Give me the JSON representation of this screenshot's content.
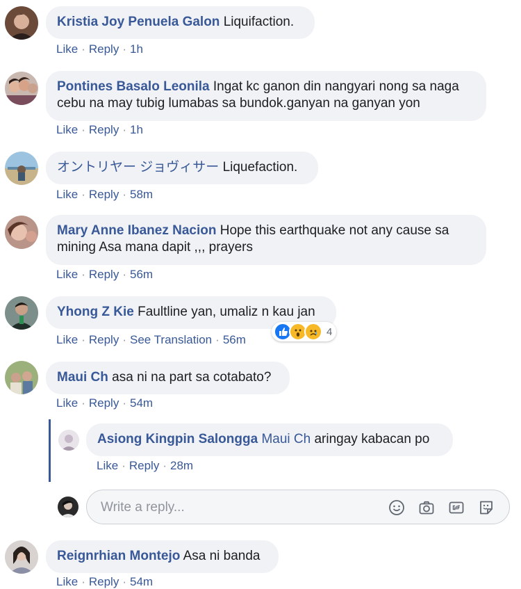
{
  "comments": [
    {
      "author": "Kristia Joy Penuela Galon",
      "text": "Liquifaction.",
      "like": "Like",
      "reply": "Reply",
      "time": "1h"
    },
    {
      "author": "Pontines Basalo Leonila",
      "text": "Ingat kc ganon din nangyari nong sa naga",
      "text2": "cebu na may tubig lumabas sa bundok.ganyan na ganyan yon",
      "like": "Like",
      "reply": "Reply",
      "time": "1h"
    },
    {
      "author": "オントリヤー ジョヴィサー",
      "text": "Liquefaction.",
      "like": "Like",
      "reply": "Reply",
      "time": "58m"
    },
    {
      "author": "Mary Anne Ibanez Nacion",
      "text": "Hope this earthquake not any cause sa",
      "text2": "mining Asa mana dapit ,,, prayers",
      "like": "Like",
      "reply": "Reply",
      "time": "56m"
    },
    {
      "author": "Yhong Z Kie",
      "text": "Faultline yan, umaliz n kau jan",
      "like": "Like",
      "reply": "Reply",
      "translate": "See Translation",
      "time": "56m",
      "reaction_count": "4"
    },
    {
      "author": "Maui Ch",
      "text": "asa ni na part sa cotabato?",
      "like": "Like",
      "reply": "Reply",
      "time": "54m"
    },
    {
      "author": "Reignrhian Montejo",
      "text": "Asa ni banda",
      "like": "Like",
      "reply": "Reply",
      "time": "54m"
    }
  ],
  "nested_reply": {
    "author": "Asiong Kingpin Salongga",
    "mention": "Maui Ch",
    "text": "aringay kabacan po",
    "like": "Like",
    "reply": "Reply",
    "time": "28m"
  },
  "reply_box": {
    "placeholder": "Write a reply..."
  },
  "icons": [
    "emoji-icon",
    "camera-icon",
    "gif-icon",
    "sticker-icon"
  ],
  "colors": {
    "link": "#385898",
    "bubble": "#f0f2f5",
    "thread": "#385898"
  }
}
